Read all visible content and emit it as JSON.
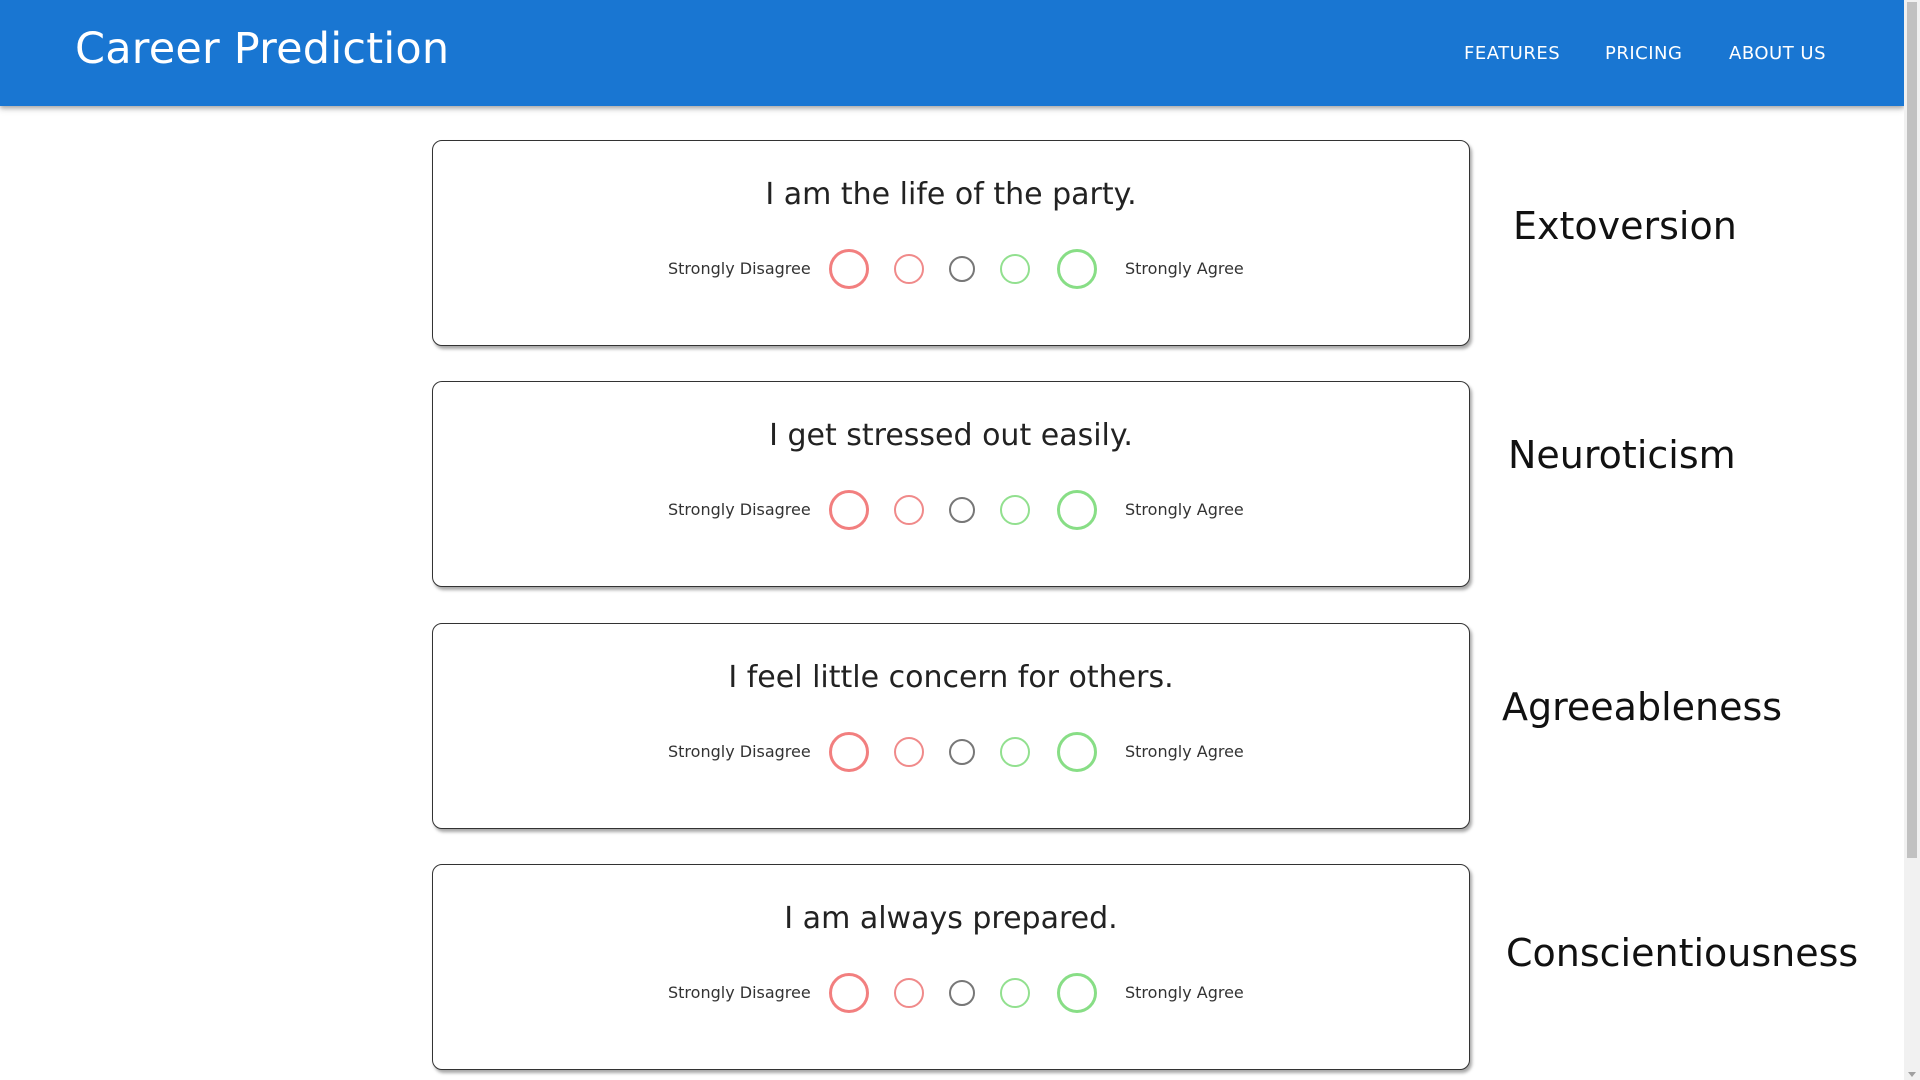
{
  "appbar": {
    "title": "Career Prediction",
    "nav": [
      "FEATURES",
      "PRICING",
      "ABOUT US"
    ],
    "color": "#1976d2"
  },
  "questions": [
    {
      "text": "I am the life of the party.",
      "left_label": "Strongly Disagree",
      "right_label": "Strongly Agree",
      "trait": "Extoversion"
    },
    {
      "text": "I get stressed out easily.",
      "left_label": "Strongly Disagree",
      "right_label": "Strongly Agree",
      "trait": "Neuroticism"
    },
    {
      "text": "I feel little concern for others.",
      "left_label": "Strongly Disagree",
      "right_label": "Strongly Agree",
      "trait": "Agreeableness"
    },
    {
      "text": "I am always prepared.",
      "left_label": "Strongly Disagree",
      "right_label": "Strongly Agree",
      "trait": "Conscientiousness"
    }
  ],
  "scale_colors": {
    "disagree": "#f27f7f",
    "neutral": "#777777",
    "agree": "#88de86"
  }
}
